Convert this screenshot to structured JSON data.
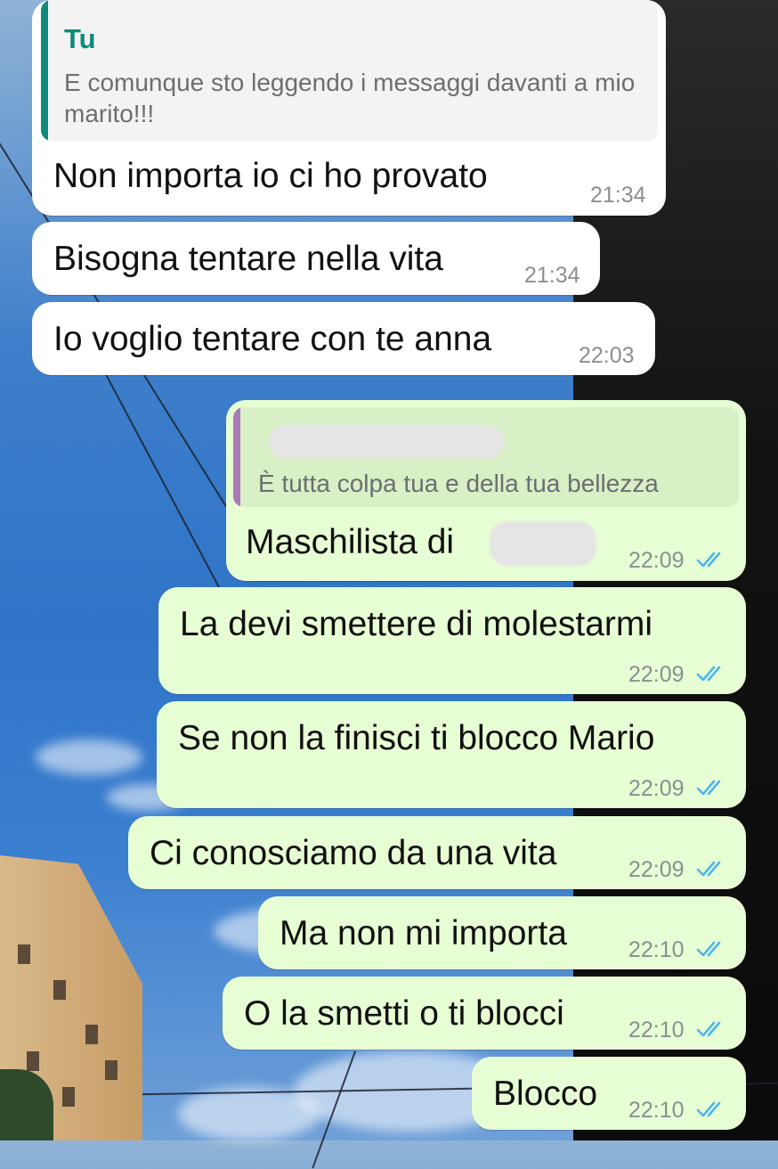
{
  "chat": {
    "messages": [
      {
        "direction": "incoming",
        "quote": {
          "author": "Tu",
          "text": "E comunque sto leggendo i messaggi davanti a mio marito!!!"
        },
        "text": "Non importa io ci ho provato",
        "time": "21:34"
      },
      {
        "direction": "incoming",
        "text": "Bisogna tentare nella vita",
        "time": "21:34"
      },
      {
        "direction": "incoming",
        "text": "Io voglio tentare con te anna",
        "time": "22:03"
      },
      {
        "direction": "outgoing",
        "quote": {
          "author": "[redacted]",
          "text": "È tutta colpa tua e della tua bellezza"
        },
        "text": "Maschilista di",
        "time": "22:09",
        "status": "read"
      },
      {
        "direction": "outgoing",
        "text": "La devi smettere di molestarmi",
        "time": "22:09",
        "status": "read"
      },
      {
        "direction": "outgoing",
        "text": "Se non la finisci ti blocco Mario",
        "time": "22:09",
        "status": "read"
      },
      {
        "direction": "outgoing",
        "text": "Ci conosciamo da una vita",
        "time": "22:09",
        "status": "read"
      },
      {
        "direction": "outgoing",
        "text": "Ma non mi importa",
        "time": "22:10",
        "status": "read"
      },
      {
        "direction": "outgoing",
        "text": "O la smetti o ti blocci",
        "time": "22:10",
        "status": "read"
      },
      {
        "direction": "outgoing",
        "text": "Blocco",
        "time": "22:10",
        "status": "read"
      }
    ]
  },
  "colors": {
    "incoming_bubble": "#ffffff",
    "outgoing_bubble": "#e7fdd3",
    "read_ticks": "#4fb6ec",
    "quote_bar_self": "#0c8a7a",
    "quote_bar_other": "#a77bb8"
  },
  "icons": {
    "read_receipt": "double-check-icon"
  }
}
